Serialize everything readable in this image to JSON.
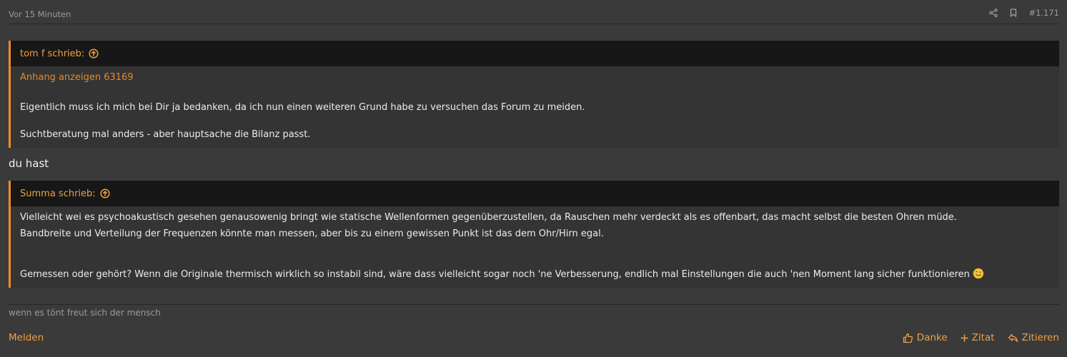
{
  "post": {
    "time": "Vor 15 Minuten",
    "number": "#1.171",
    "icons": {
      "share": "share-icon",
      "bookmark": "bookmark-icon"
    }
  },
  "quote1": {
    "author": "tom f schrieb:",
    "attachment_link": "Anhang anzeigen 63169",
    "paragraphs": [
      "Eigentlich muss ich mich bei Dir ja bedanken, da ich nun einen weiteren Grund habe zu versuchen das Forum zu meiden.",
      "Suchtberatung mal anders - aber hauptsache die Bilanz passt."
    ]
  },
  "reply": "du hast",
  "quote2": {
    "author": "Summa schrieb:",
    "paragraphs": [
      "Vielleicht wei es psychoakustisch gesehen genausowenig bringt wie statische Wellenformen gegenüberzustellen, da Rauschen mehr verdeckt als es offenbart, das macht selbst die besten Ohren müde.",
      "Bandbreite und Verteilung der Frequenzen könnte man messen, aber bis zu einem gewissen Punkt ist das dem Ohr/Hirn egal.",
      "Gemessen oder gehört? Wenn die Originale thermisch wirklich so instabil sind, wäre dass vielleicht sogar noch 'ne Verbesserung, endlich mal Einstellungen die auch 'nen Moment lang sicher funktionieren"
    ]
  },
  "signature": "wenn es tönt freut sich der mensch",
  "footer": {
    "report": "Melden",
    "like": "Danke",
    "multiquote": "Zitat",
    "reply": "Zitieren"
  },
  "colors": {
    "background": "#3a3a3a",
    "quote_bar": "#f28c28",
    "link": "#f0a040",
    "quote_header": "#171717"
  }
}
